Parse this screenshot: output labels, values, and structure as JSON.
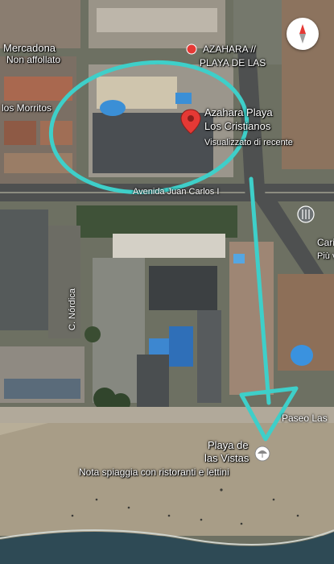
{
  "map": {
    "labels": {
      "mercadona": "Mercadona",
      "mercadona_sub": "Non affollato",
      "morritos": "los Morritos",
      "azahara_top_1": "AZAHARA //",
      "azahara_top_2": "PLAYA DE LAS",
      "hotel_name_1": "Azahara Playa",
      "hotel_name_2": "Los Cristianos",
      "hotel_sub": "Visualizzato di recente",
      "road_top": "Avenida Juan Carlos I",
      "c_nordica": "C. Nórdica",
      "carism_1": "Carism",
      "carism_2": "Più vot",
      "paseo": "Paseo Las",
      "beach_1": "Playa de",
      "beach_2": "las Vistas",
      "beach_sub": "Nota spiaggia con ristoranti e lettini"
    },
    "icons": {
      "compass": "compass-icon",
      "hotel_pin": "red-location-pin-icon",
      "beach_pin": "beach-umbrella-pin-icon",
      "restaurant": "fork-knife-icon",
      "azahara_marker": "red-marker-icon"
    },
    "colors": {
      "annotation": "#3ecfc9",
      "pin": "#e53935",
      "sea": "#2f4650",
      "sand": "#a79c86"
    }
  }
}
